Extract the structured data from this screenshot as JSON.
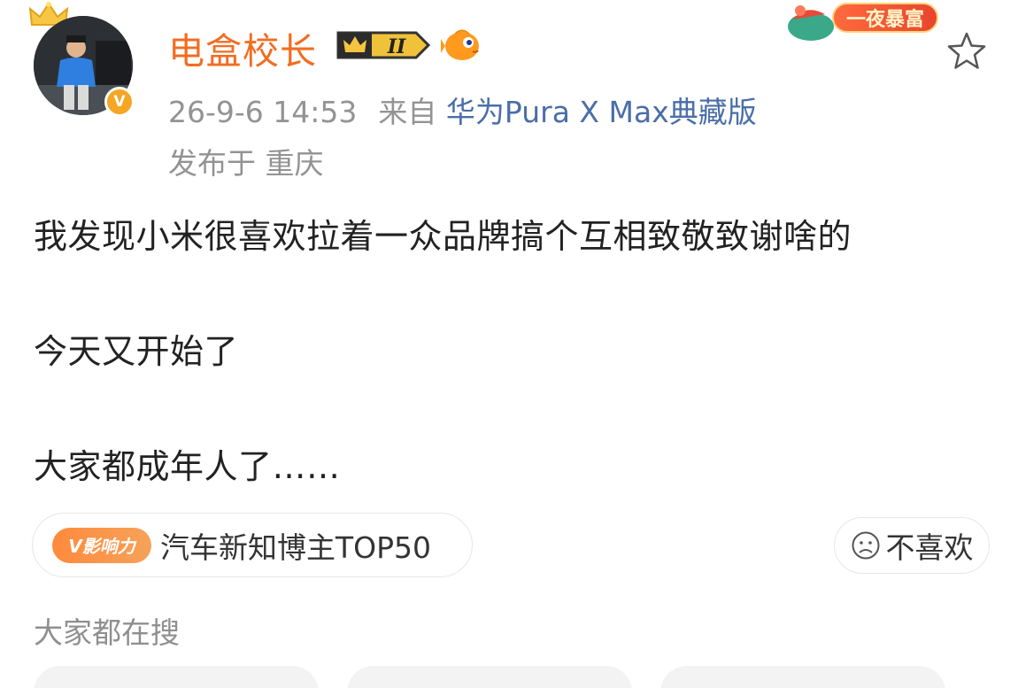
{
  "user": {
    "name": "电盒校长",
    "verified_mark": "V",
    "level_badge": "II"
  },
  "meta": {
    "time": "26-9-6 14:53",
    "source_prefix": "来自",
    "device": "华为Pura X Max典藏版",
    "location": "发布于 重庆"
  },
  "promo": {
    "label": "一夜暴富"
  },
  "post": {
    "lines": [
      "我发现小米很喜欢拉着一众品牌搞个互相致敬致谢啥的",
      "今天又开始了",
      "大家都成年人了……"
    ]
  },
  "tag": {
    "badge": "V影响力",
    "text": "汽车新知博主TOP50"
  },
  "dislike": {
    "label": "不喜欢"
  },
  "trending": {
    "title": "大家都在搜"
  },
  "colors": {
    "username": "#f26d21",
    "device_link": "#4a6ea8",
    "meta_gray": "#939393",
    "influence_orange": "#ff8a3c"
  },
  "icons": [
    "crown-icon",
    "verified-icon",
    "level-badge-icon",
    "fish-icon",
    "star-icon",
    "sad-face-icon"
  ]
}
